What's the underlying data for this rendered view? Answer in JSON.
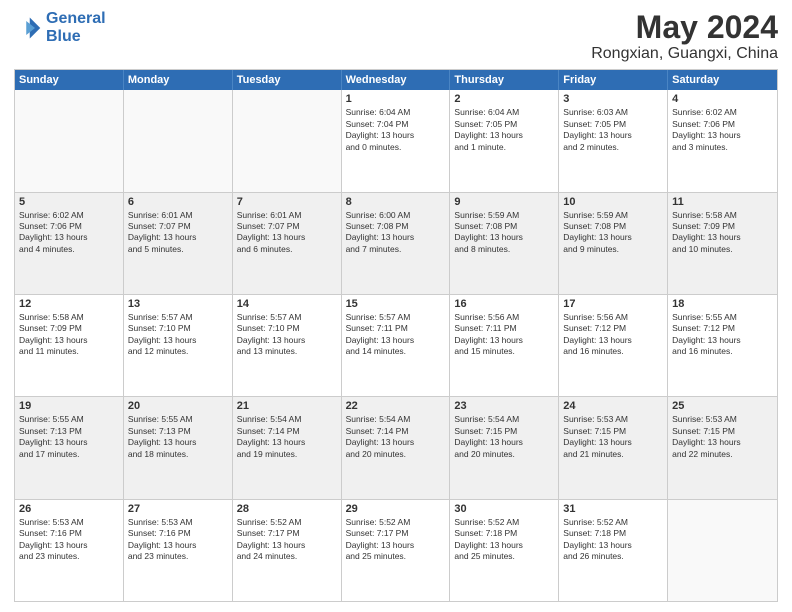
{
  "header": {
    "logo_line1": "General",
    "logo_line2": "Blue",
    "main_title": "May 2024",
    "subtitle": "Rongxian, Guangxi, China"
  },
  "weekdays": [
    "Sunday",
    "Monday",
    "Tuesday",
    "Wednesday",
    "Thursday",
    "Friday",
    "Saturday"
  ],
  "rows": [
    [
      {
        "day": "",
        "info": ""
      },
      {
        "day": "",
        "info": ""
      },
      {
        "day": "",
        "info": ""
      },
      {
        "day": "1",
        "info": "Sunrise: 6:04 AM\nSunset: 7:04 PM\nDaylight: 13 hours\nand 0 minutes."
      },
      {
        "day": "2",
        "info": "Sunrise: 6:04 AM\nSunset: 7:05 PM\nDaylight: 13 hours\nand 1 minute."
      },
      {
        "day": "3",
        "info": "Sunrise: 6:03 AM\nSunset: 7:05 PM\nDaylight: 13 hours\nand 2 minutes."
      },
      {
        "day": "4",
        "info": "Sunrise: 6:02 AM\nSunset: 7:06 PM\nDaylight: 13 hours\nand 3 minutes."
      }
    ],
    [
      {
        "day": "5",
        "info": "Sunrise: 6:02 AM\nSunset: 7:06 PM\nDaylight: 13 hours\nand 4 minutes."
      },
      {
        "day": "6",
        "info": "Sunrise: 6:01 AM\nSunset: 7:07 PM\nDaylight: 13 hours\nand 5 minutes."
      },
      {
        "day": "7",
        "info": "Sunrise: 6:01 AM\nSunset: 7:07 PM\nDaylight: 13 hours\nand 6 minutes."
      },
      {
        "day": "8",
        "info": "Sunrise: 6:00 AM\nSunset: 7:08 PM\nDaylight: 13 hours\nand 7 minutes."
      },
      {
        "day": "9",
        "info": "Sunrise: 5:59 AM\nSunset: 7:08 PM\nDaylight: 13 hours\nand 8 minutes."
      },
      {
        "day": "10",
        "info": "Sunrise: 5:59 AM\nSunset: 7:08 PM\nDaylight: 13 hours\nand 9 minutes."
      },
      {
        "day": "11",
        "info": "Sunrise: 5:58 AM\nSunset: 7:09 PM\nDaylight: 13 hours\nand 10 minutes."
      }
    ],
    [
      {
        "day": "12",
        "info": "Sunrise: 5:58 AM\nSunset: 7:09 PM\nDaylight: 13 hours\nand 11 minutes."
      },
      {
        "day": "13",
        "info": "Sunrise: 5:57 AM\nSunset: 7:10 PM\nDaylight: 13 hours\nand 12 minutes."
      },
      {
        "day": "14",
        "info": "Sunrise: 5:57 AM\nSunset: 7:10 PM\nDaylight: 13 hours\nand 13 minutes."
      },
      {
        "day": "15",
        "info": "Sunrise: 5:57 AM\nSunset: 7:11 PM\nDaylight: 13 hours\nand 14 minutes."
      },
      {
        "day": "16",
        "info": "Sunrise: 5:56 AM\nSunset: 7:11 PM\nDaylight: 13 hours\nand 15 minutes."
      },
      {
        "day": "17",
        "info": "Sunrise: 5:56 AM\nSunset: 7:12 PM\nDaylight: 13 hours\nand 16 minutes."
      },
      {
        "day": "18",
        "info": "Sunrise: 5:55 AM\nSunset: 7:12 PM\nDaylight: 13 hours\nand 16 minutes."
      }
    ],
    [
      {
        "day": "19",
        "info": "Sunrise: 5:55 AM\nSunset: 7:13 PM\nDaylight: 13 hours\nand 17 minutes."
      },
      {
        "day": "20",
        "info": "Sunrise: 5:55 AM\nSunset: 7:13 PM\nDaylight: 13 hours\nand 18 minutes."
      },
      {
        "day": "21",
        "info": "Sunrise: 5:54 AM\nSunset: 7:14 PM\nDaylight: 13 hours\nand 19 minutes."
      },
      {
        "day": "22",
        "info": "Sunrise: 5:54 AM\nSunset: 7:14 PM\nDaylight: 13 hours\nand 20 minutes."
      },
      {
        "day": "23",
        "info": "Sunrise: 5:54 AM\nSunset: 7:15 PM\nDaylight: 13 hours\nand 20 minutes."
      },
      {
        "day": "24",
        "info": "Sunrise: 5:53 AM\nSunset: 7:15 PM\nDaylight: 13 hours\nand 21 minutes."
      },
      {
        "day": "25",
        "info": "Sunrise: 5:53 AM\nSunset: 7:15 PM\nDaylight: 13 hours\nand 22 minutes."
      }
    ],
    [
      {
        "day": "26",
        "info": "Sunrise: 5:53 AM\nSunset: 7:16 PM\nDaylight: 13 hours\nand 23 minutes."
      },
      {
        "day": "27",
        "info": "Sunrise: 5:53 AM\nSunset: 7:16 PM\nDaylight: 13 hours\nand 23 minutes."
      },
      {
        "day": "28",
        "info": "Sunrise: 5:52 AM\nSunset: 7:17 PM\nDaylight: 13 hours\nand 24 minutes."
      },
      {
        "day": "29",
        "info": "Sunrise: 5:52 AM\nSunset: 7:17 PM\nDaylight: 13 hours\nand 25 minutes."
      },
      {
        "day": "30",
        "info": "Sunrise: 5:52 AM\nSunset: 7:18 PM\nDaylight: 13 hours\nand 25 minutes."
      },
      {
        "day": "31",
        "info": "Sunrise: 5:52 AM\nSunset: 7:18 PM\nDaylight: 13 hours\nand 26 minutes."
      },
      {
        "day": "",
        "info": ""
      }
    ]
  ]
}
